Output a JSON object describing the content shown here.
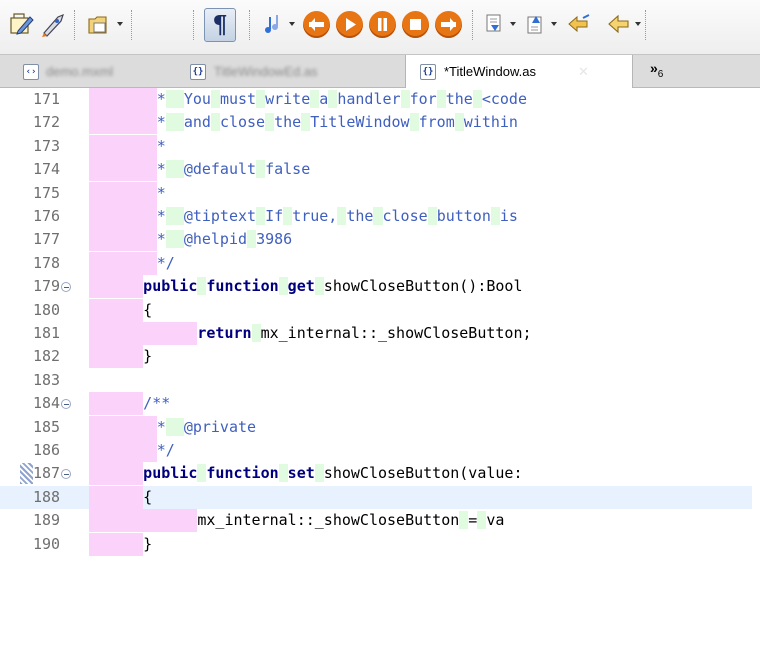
{
  "toolbar": {
    "pilcrow": "¶"
  },
  "tabs": [
    {
      "label": "demo.mxml",
      "icon": "mxml-file-icon",
      "active": false
    },
    {
      "label": "TitleWindowEd.as",
      "icon": "as-file-icon",
      "active": false
    },
    {
      "label": "*TitleWindow.as",
      "icon": "as-file-icon",
      "active": true
    }
  ],
  "tab_overflow": {
    "symbol": "»",
    "count": "6"
  },
  "colors": {
    "indent_pink": "#fad2fa",
    "indent_green": "#e1fbe1",
    "comment": "#3f5fbf",
    "keyword": "#00007f",
    "current_line": "#e8f2fe"
  },
  "editor": {
    "lines": [
      {
        "num": "171",
        "text": "     *  You must write a handler for the <code"
      },
      {
        "num": "172",
        "text": "     *  and close the TitleWindow from within"
      },
      {
        "num": "173",
        "text": "     *"
      },
      {
        "num": "174",
        "text": "     *  @default false"
      },
      {
        "num": "175",
        "text": "     *"
      },
      {
        "num": "176",
        "text": "     *  @tiptext If true, the close button is"
      },
      {
        "num": "177",
        "text": "     *  @helpid 3986"
      },
      {
        "num": "178",
        "text": "     */"
      },
      {
        "num": "179",
        "text": "    public function get showCloseButton():Bool"
      },
      {
        "num": "180",
        "text": "    {"
      },
      {
        "num": "181",
        "text": "        return mx_internal::_showCloseButton;"
      },
      {
        "num": "182",
        "text": "    }"
      },
      {
        "num": "183",
        "text": ""
      },
      {
        "num": "184",
        "text": "    /**"
      },
      {
        "num": "185",
        "text": "     *  @private"
      },
      {
        "num": "186",
        "text": "     */"
      },
      {
        "num": "187",
        "text": "    public function set showCloseButton(value:"
      },
      {
        "num": "188",
        "text": "    {"
      },
      {
        "num": "189",
        "text": "        mx_internal::_showCloseButton = va"
      },
      {
        "num": "190",
        "text": "    }"
      }
    ]
  }
}
